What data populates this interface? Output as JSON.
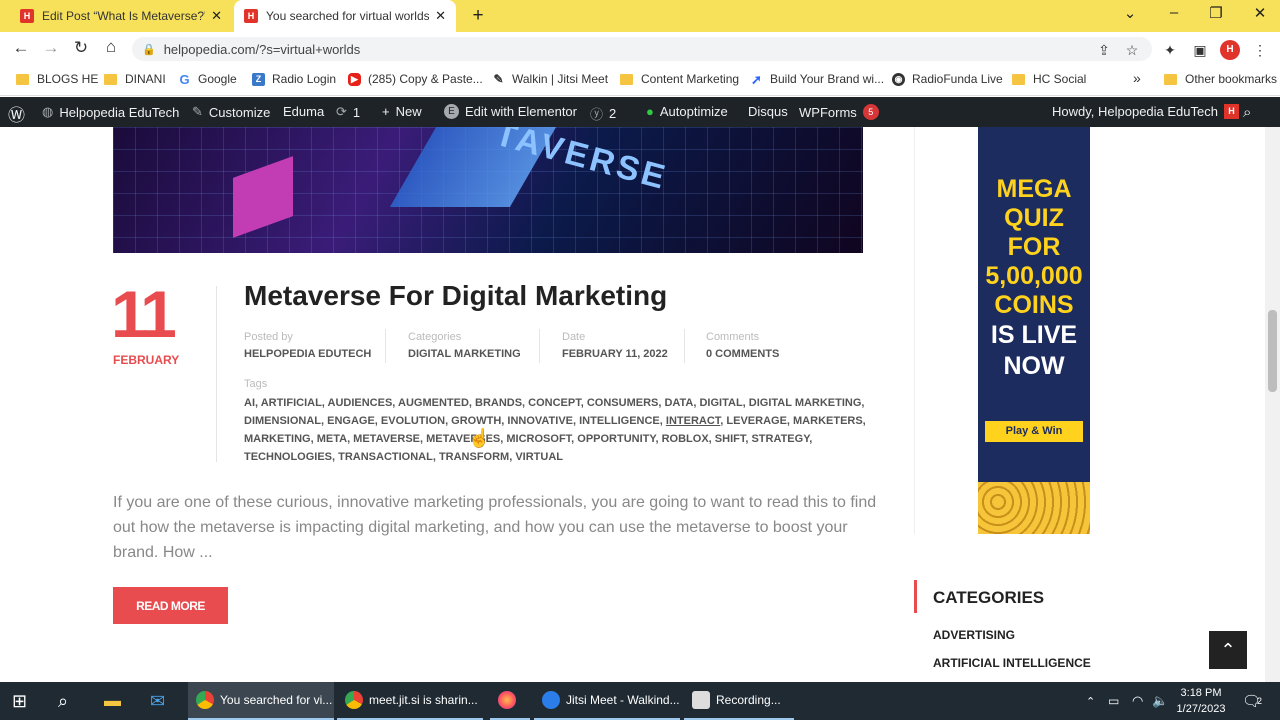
{
  "browser": {
    "tabs": [
      {
        "title": "Edit Post “What Is Metaverse?” ‹ H",
        "favicon": "H"
      },
      {
        "title": "You searched for virtual worlds - H",
        "favicon": "H"
      }
    ],
    "new_tab": "+",
    "url": "helpopedia.com/?s=virtual+worlds",
    "bookmarks": [
      {
        "label": "BLOGS HE",
        "icon": "folder-icon"
      },
      {
        "label": "DINANI",
        "icon": "folder-icon"
      },
      {
        "label": "Google",
        "icon": "google-icon"
      },
      {
        "label": "Radio Login",
        "icon": "zoho-icon"
      },
      {
        "label": "(285) Copy & Paste...",
        "icon": "youtube-icon"
      },
      {
        "label": "Walkin | Jitsi Meet",
        "icon": "jitsi-icon"
      },
      {
        "label": "Content Marketing",
        "icon": "folder-icon"
      },
      {
        "label": "Build Your Brand wi...",
        "icon": "arrow-icon"
      },
      {
        "label": "RadioFunda Live",
        "icon": "globe-icon"
      },
      {
        "label": "HC Social",
        "icon": "folder-icon"
      }
    ],
    "more_bookmarks": "»",
    "other_bookmarks": "Other bookmarks"
  },
  "wpbar": {
    "site": "Helpopedia EduTech",
    "customize": "Customize",
    "theme": "Eduma",
    "updates": "1",
    "new": "New",
    "elementor": "Edit with Elementor",
    "yoast_count": "2",
    "autoptimize": "Autoptimize",
    "disqus": "Disqus",
    "wpforms": "WPForms",
    "wpforms_count": "5",
    "howdy": "Howdy, Helpopedia EduTech"
  },
  "post": {
    "day": "11",
    "month": "FEBRUARY",
    "title": "Metaverse For Digital Marketing",
    "meta": [
      {
        "label": "Posted by",
        "value": "HELPOPEDIA EDUTECH"
      },
      {
        "label": "Categories",
        "value": "DIGITAL MARKETING"
      },
      {
        "label": "Date",
        "value": "FEBRUARY 11, 2022"
      },
      {
        "label": "Comments",
        "value": "0 COMMENTS"
      }
    ],
    "tags_label": "Tags",
    "tags_line1": "AI, ARTIFICIAL, AUDIENCES, AUGMENTED, BRANDS, CONCEPT, CONSUMERS, DATA, DIGITAL, DIGITAL MARKETING,",
    "tags_line2a": "DIMENSIONAL, ENGAGE, EVOLUTION, GROWTH, INNOVATIVE, INTELLIGENCE, ",
    "tags_line2b": "INTERACT",
    "tags_line2c": ", LEVERAGE, MARKETERS,",
    "tags_line3": "MARKETING, META, METAVERSE, METAVERSES, MICROSOFT, OPPORTUNITY, ROBLOX, SHIFT, STRATEGY,",
    "tags_line4": "TECHNOLOGIES, TRANSACTIONAL, TRANSFORM, VIRTUAL",
    "excerpt": "If you are one of these curious, innovative marketing professionals, you are going to want to read this to find out how the metaverse is impacting digital marketing, and how you can use the metaverse to boost your brand. How ...",
    "read_more": "READ MORE",
    "hero_text": "TAVERSE"
  },
  "ad": {
    "line1": "MEGA",
    "line2": "QUIZ",
    "line3": "FOR",
    "line4": "5,00,000",
    "line5": "COINS",
    "line6": "IS LIVE",
    "line7": "NOW",
    "button": "Play & Win"
  },
  "sidebar": {
    "categories_title": "CATEGORIES",
    "categories": [
      "ADVERTISING",
      "ARTIFICIAL INTELLIGENCE"
    ]
  },
  "taskbar": {
    "apps": [
      {
        "label": "You searched for vi...",
        "icon": "chrome-icon"
      },
      {
        "label": "meet.jit.si is sharin...",
        "icon": "chrome-icon"
      },
      {
        "label": "",
        "icon": "firefox-icon"
      },
      {
        "label": "Jitsi Meet - Walkind...",
        "icon": "jitsi-icon"
      },
      {
        "label": "Recording...",
        "icon": "recorder-icon"
      }
    ],
    "time": "3:18 PM",
    "date": "1/27/2023",
    "notifications": "2"
  },
  "colors": {
    "accent": "#e84c4f",
    "tabbar": "#f7e15a",
    "wpbar": "#1d2327",
    "ad_bg": "#1c2c5e",
    "ad_yellow": "#ffd21e"
  }
}
